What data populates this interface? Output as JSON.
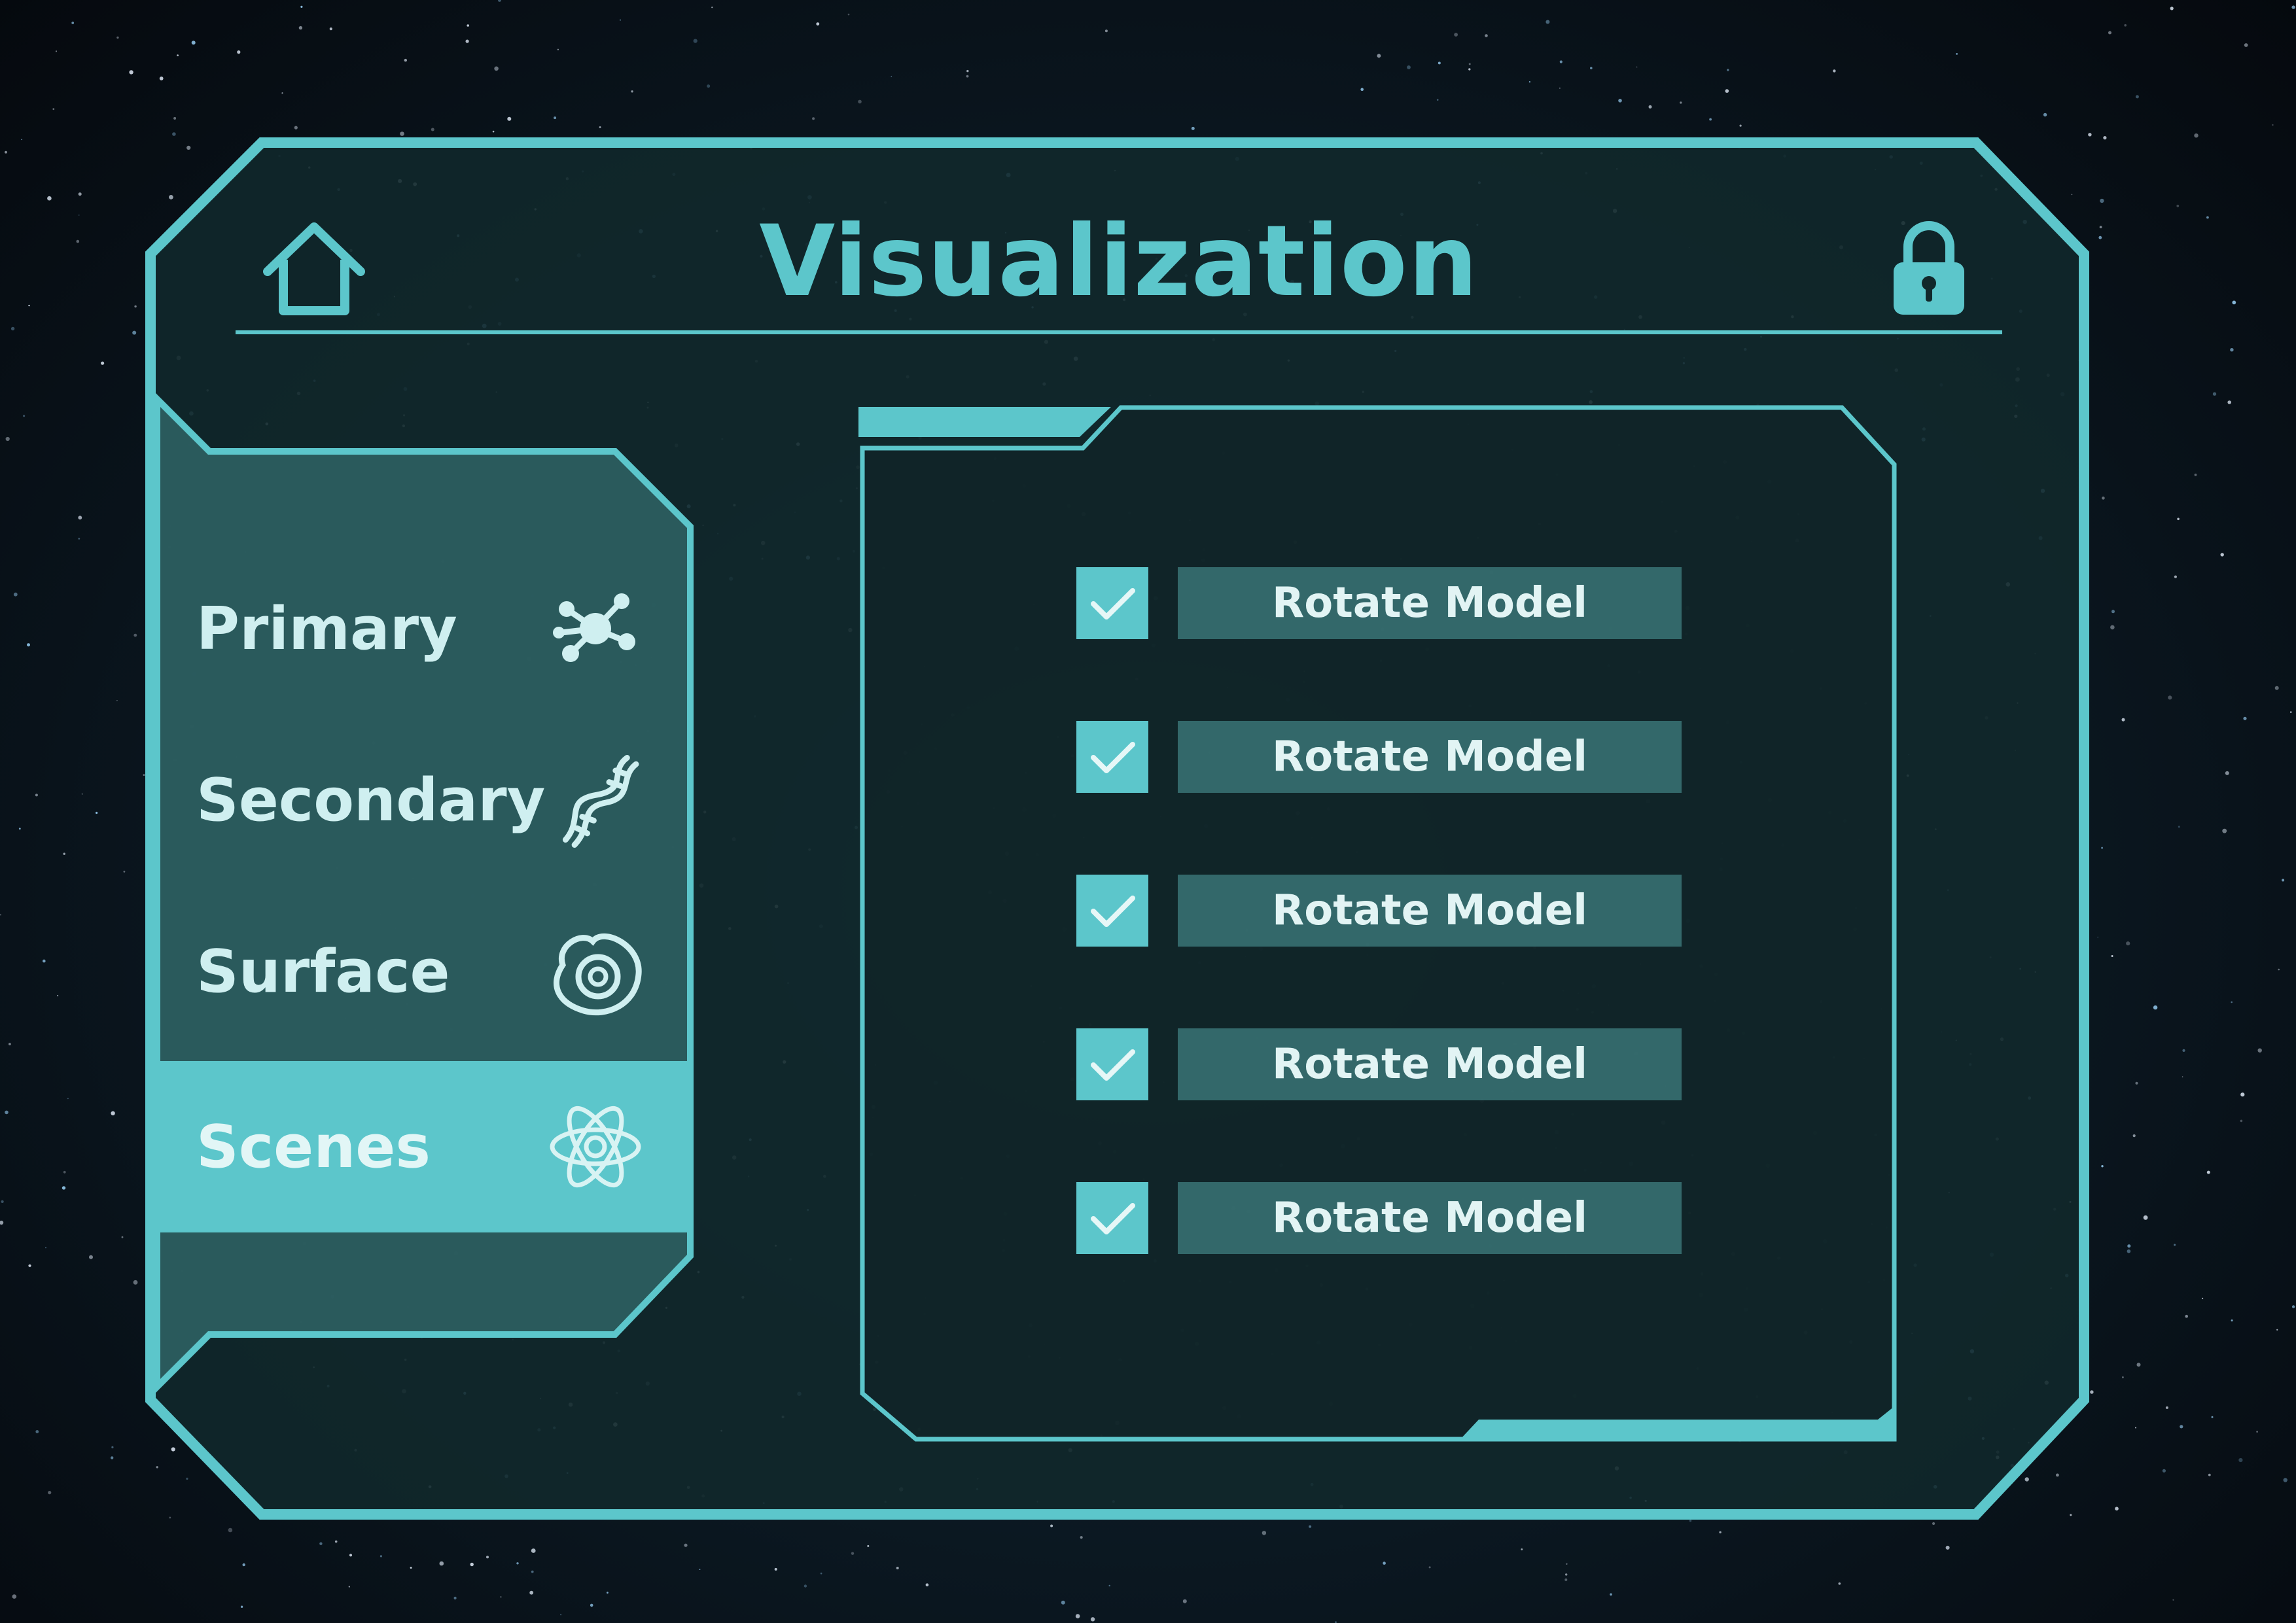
{
  "header": {
    "title": "Visualization",
    "home_icon": "house-icon",
    "lock_icon": "padlock-icon"
  },
  "sidebar": {
    "items": [
      {
        "label": "Primary",
        "icon": "molecule-network-icon",
        "active": false
      },
      {
        "label": "Secondary",
        "icon": "dna-helix-icon",
        "active": false
      },
      {
        "label": "Surface",
        "icon": "cell-surface-icon",
        "active": false
      },
      {
        "label": "Scenes",
        "icon": "atom-icon",
        "active": true
      }
    ]
  },
  "options": [
    {
      "label": "Rotate Model",
      "checked": true
    },
    {
      "label": "Rotate Model",
      "checked": true
    },
    {
      "label": "Rotate Model",
      "checked": true
    },
    {
      "label": "Rotate Model",
      "checked": true
    },
    {
      "label": "Rotate Model",
      "checked": true
    }
  ],
  "colors": {
    "accent": "#5cc6cb",
    "panel": "#11282b",
    "sidebar": "#2c5e61",
    "background": "#0a121b"
  }
}
